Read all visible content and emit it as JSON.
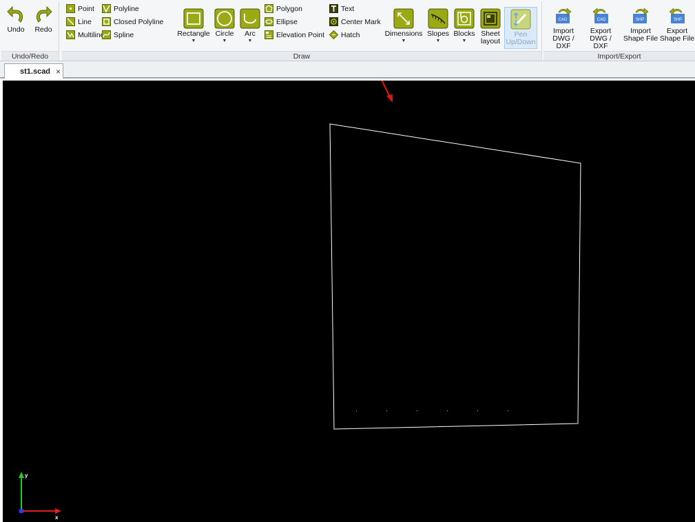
{
  "ribbon": {
    "undo_redo": {
      "undo_label": "Undo",
      "redo_label": "Redo",
      "caption": "Undo/Redo"
    },
    "draw": {
      "caption": "Draw",
      "col1": [
        {
          "label": "Point",
          "icon": "point-icon"
        },
        {
          "label": "Line",
          "icon": "line-icon"
        },
        {
          "label": "Multiline",
          "icon": "multiline-icon"
        }
      ],
      "col2": [
        {
          "label": "Polyline",
          "icon": "polyline-icon"
        },
        {
          "label": "Closed Polyline",
          "icon": "closed-polyline-icon"
        },
        {
          "label": "Spline",
          "icon": "spline-icon"
        }
      ],
      "rectangle_label": "Rectangle",
      "circle_label": "Circle",
      "arc_label": "Arc",
      "col3": [
        {
          "label": "Polygon",
          "icon": "polygon-icon"
        },
        {
          "label": "Ellipse",
          "icon": "ellipse-icon"
        },
        {
          "label": "Elevation Point",
          "icon": "elevation-point-icon"
        }
      ],
      "col4": [
        {
          "label": "Text",
          "icon": "text-icon"
        },
        {
          "label": "Center Mark",
          "icon": "center-mark-icon"
        },
        {
          "label": "Hatch",
          "icon": "hatch-icon"
        }
      ],
      "dimensions_label": "Dimensions",
      "slopes_label": "Slopes",
      "blocks_label": "Blocks",
      "sheet_label_1": "Sheet",
      "sheet_label_2": "layout",
      "pen_label_1": "Pen",
      "pen_label_2": "Up/Down"
    },
    "import_export": {
      "caption": "Import/Export",
      "import_dwg_1": "Import",
      "import_dwg_2": "DWG / DXF",
      "export_dwg_1": "Export",
      "export_dwg_2": "DWG / DXF",
      "import_shp_1": "Import",
      "import_shp_2": "Shape File",
      "export_shp_1": "Export",
      "export_shp_2": "Shape File",
      "cad_badge": "CAD",
      "shp_badge": "SHP"
    }
  },
  "tabs": [
    {
      "label": "st1.scad",
      "close": "×",
      "active": true
    }
  ],
  "axes": {
    "x_label": "x",
    "y_label": "y",
    "x_color": "#e02020",
    "y_color": "#20d020"
  },
  "colors": {
    "icon_green": "#9aaa14",
    "icon_dark": "#3a3f07",
    "canvas_bg": "#000000",
    "shape_stroke": "#ffffff",
    "annotation_arrow": "#e01515"
  }
}
